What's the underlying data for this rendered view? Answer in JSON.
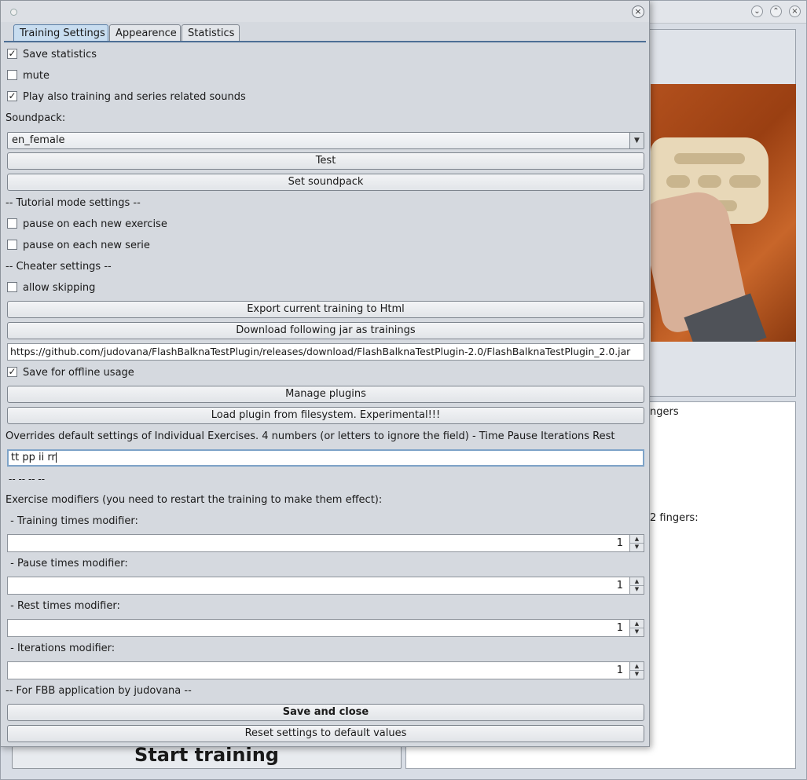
{
  "background_window": {
    "text_fragment_1": "ngers",
    "text_fragment_2": "2 fingers:",
    "start_button": "Start training"
  },
  "dialog": {
    "close_glyph": "×",
    "tabs": [
      {
        "label": "Training Settings",
        "active": true
      },
      {
        "label": "Appearence",
        "active": false
      },
      {
        "label": "Statistics",
        "active": false
      }
    ],
    "save_statistics": {
      "label": "Save statistics",
      "checked": true
    },
    "mute": {
      "label": "mute",
      "checked": false
    },
    "play_sounds": {
      "label": "Play also training and series related sounds",
      "checked": true
    },
    "soundpack_label": "Soundpack:",
    "soundpack_value": "en_female",
    "test_button": "Test",
    "set_soundpack_button": "Set soundpack",
    "tutorial_header": "--  Tutorial mode settings --",
    "pause_exercise": {
      "label": "pause on each new exercise",
      "checked": false
    },
    "pause_serie": {
      "label": "pause on each new serie",
      "checked": false
    },
    "cheater_header": "-- Cheater settings --",
    "allow_skipping": {
      "label": "allow skipping",
      "checked": false
    },
    "export_button": "Export current training to Html",
    "download_button": "Download following jar as trainings",
    "jar_url": "https://github.com/judovana/FlashBalknaTestPlugin/releases/download/FlashBalknaTestPlugin-2.0/FlashBalknaTestPlugin_2.0.jar",
    "offline_usage": {
      "label": "Save for offline usage",
      "checked": true
    },
    "manage_plugins_button": "Manage plugins",
    "load_plugin_button": "Load plugin from filesystem. Experimental!!!",
    "overrides_label": "Overrides default settings of Individual Exercises. 4 numbers (or letters to ignore the field) - Time Pause Iterations Rest",
    "overrides_value": "tt pp ii rr",
    "separator_text": "-- -- -- --",
    "modifiers_header": "Exercise modifiers (you need to restart the training to make them effect):",
    "modifiers": [
      {
        "label": " - Training times modifier:",
        "value": "1"
      },
      {
        "label": " - Pause times modifier:",
        "value": "1"
      },
      {
        "label": " - Rest times modifier:",
        "value": "1"
      },
      {
        "label": " - Iterations modifier:",
        "value": "1"
      }
    ],
    "footer_text": "-- For FBB application by judovana --",
    "save_close_button": "Save and close",
    "reset_button": "Reset settings to default values"
  },
  "icons": {
    "check": "✓",
    "combo_arrow": "▼",
    "spin_up": "▲",
    "spin_down": "▼",
    "minimize": "⌄",
    "maximize": "⌃",
    "close": "×"
  }
}
